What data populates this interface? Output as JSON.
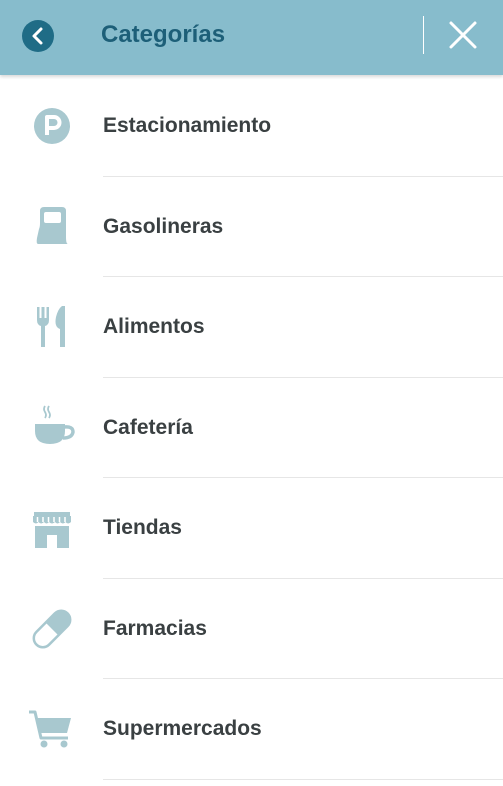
{
  "header": {
    "title": "Categorías",
    "back_icon": "chevron-left-icon",
    "close_icon": "close-icon"
  },
  "colors": {
    "header_bg": "#87bccc",
    "title": "#1d5f78",
    "icon": "#a8c8cf",
    "label": "#3a4042"
  },
  "categories": [
    {
      "label": "Estacionamiento",
      "icon": "parking-icon"
    },
    {
      "label": "Gasolineras",
      "icon": "gas-pump-icon"
    },
    {
      "label": "Alimentos",
      "icon": "fork-knife-icon"
    },
    {
      "label": "Cafetería",
      "icon": "coffee-cup-icon"
    },
    {
      "label": "Tiendas",
      "icon": "storefront-icon"
    },
    {
      "label": "Farmacias",
      "icon": "pill-icon"
    },
    {
      "label": "Supermercados",
      "icon": "shopping-cart-icon"
    }
  ]
}
